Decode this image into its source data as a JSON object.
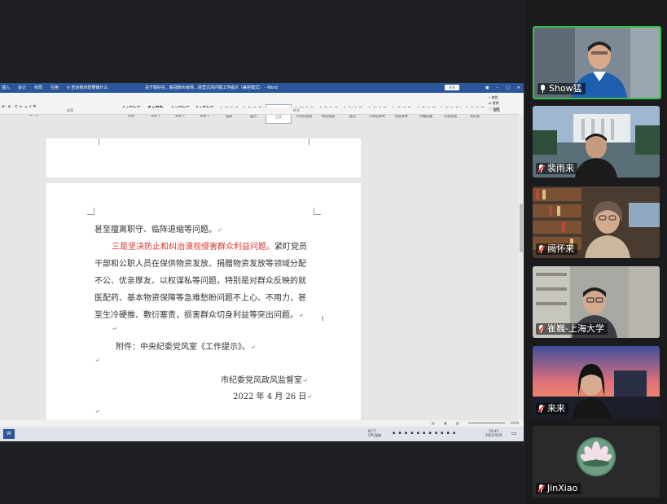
{
  "word": {
    "title": "关于做好在…新冠肺炎疫情…经营文风问题工作提示（兼容模式） - Word",
    "menu": [
      "插入",
      "设计",
      "布局",
      "引用",
      "邮件",
      "审阅",
      "视图",
      "帮助"
    ],
    "tell_me": "告诉我你想要做什么",
    "share": "共享",
    "style_tiles": [
      {
        "sample": "AaBbC",
        "label": "标题"
      },
      {
        "sample": "AaBb",
        "label": "标题 1"
      },
      {
        "sample": "AaBbC",
        "label": "标题 2"
      },
      {
        "sample": "AaBbC",
        "label": "标题 3"
      },
      {
        "sample": "AaBbCcD",
        "label": "强调"
      },
      {
        "sample": "AaBbCcDd",
        "label": "要点"
      },
      {
        "sample": "AaBbCcDd",
        "label": "正文"
      },
      {
        "sample": "AaBbCcD",
        "label": "不明显强调"
      },
      {
        "sample": "AaBbCcD",
        "label": "明显强调"
      },
      {
        "sample": "AaBbCcD",
        "label": "要点"
      },
      {
        "sample": "AaBbCcD",
        "label": "不明显参考"
      },
      {
        "sample": "AaBbCcD",
        "label": "明显参考"
      },
      {
        "sample": "AaBbCcD",
        "label": "书籍标题"
      },
      {
        "sample": "AaBbCcDd",
        "label": "列表段落"
      },
      {
        "sample": "AaBbCcD",
        "label": "非标准"
      }
    ],
    "group_paragraph": "段落",
    "group_styles": "样式",
    "group_editing": "编辑",
    "right_tools": [
      "查找",
      "替换",
      "选择"
    ],
    "doc_lines": [
      "甚至擅离职守、临阵退缩等问题。",
      "三是坚决防止和纠治漠视侵害群众利益问题。",
      "紧盯党员",
      "干部和公职人员在保供物资发放、捐赠物资发放等领域分配",
      "不公、优亲厚友、以权谋私等问题，特别是对群众反映的就",
      "医配药、基本物资保障等急难愁盼问题不上心、不用力，甚",
      "至生冷硬推、敷衍塞责，损害群众切身利益等突出问题。",
      "附件：中央纪委党风室《工作提示》。",
      "市纪委党风政风监督室",
      "2022 年 4 月 26 日"
    ],
    "zoom": "120%",
    "weather_temp": "61°C",
    "weather_desc": "CPU温度",
    "time": "10:45",
    "date": "2022/4/26"
  },
  "participants": [
    {
      "name": "Show猛",
      "active": true
    },
    {
      "name": "裴雨来",
      "active": false
    },
    {
      "name": "阙怀来",
      "active": false
    },
    {
      "name": "崔巍-上海大学",
      "active": false
    },
    {
      "name": "来来",
      "active": false
    },
    {
      "name": "JinXiao",
      "active": false
    }
  ],
  "colors": {
    "accent_green": "#35c04a",
    "word_blue": "#2b579a",
    "red_text": "#d8322a"
  }
}
